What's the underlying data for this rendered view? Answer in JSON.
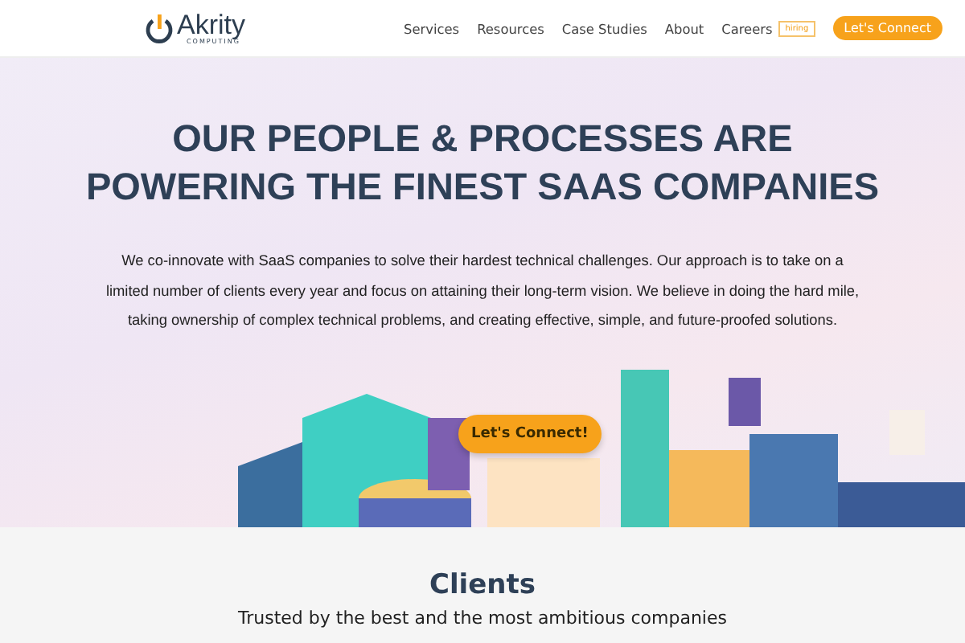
{
  "header": {
    "logo_name": "Akrity",
    "logo_sub": "COMPUTING",
    "nav": [
      {
        "label": "Services"
      },
      {
        "label": "Resources"
      },
      {
        "label": "Case Studies"
      },
      {
        "label": "About"
      },
      {
        "label": "Careers",
        "badge": "hiring"
      }
    ],
    "cta": "Let's Connect"
  },
  "hero": {
    "headline": [
      "OUR PEOPLE & PROCESSES ARE",
      "POWERING THE FINEST SAAS COMPANIES"
    ],
    "text": "We co-innovate with SaaS companies to solve their hardest technical challenges. Our approach is to take on a limited number of clients every year and focus on attaining their long-term vision. We believe in doing the hard mile, taking ownership of complex technical problems, and creating effective, simple, and future-proofed solutions.",
    "button": "Let's Connect!"
  },
  "clients": {
    "title": "Clients",
    "subtitle": "Trusted by the best and the most ambitious companies"
  }
}
